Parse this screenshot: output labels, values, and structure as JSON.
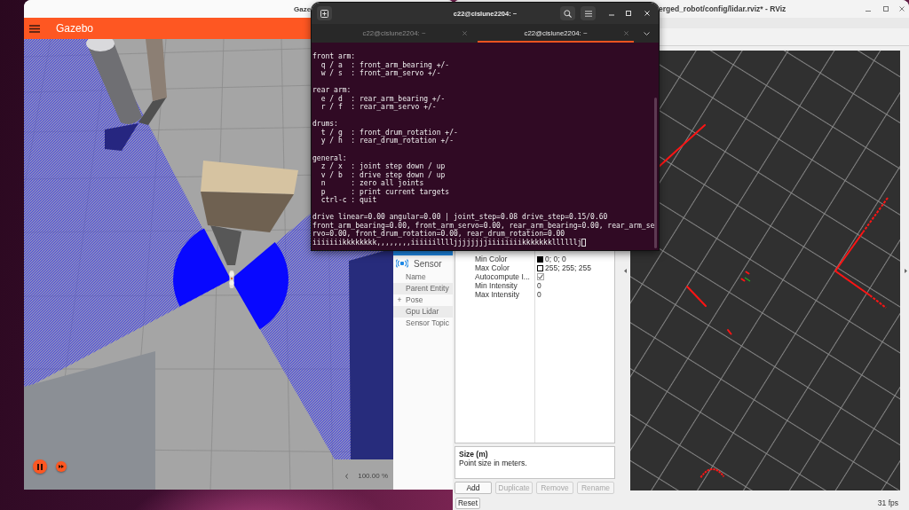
{
  "gazebo": {
    "title": "Gaze",
    "app_name": "Gazebo",
    "playing": true,
    "zoom": "100.00 %",
    "panel": {
      "title": "Sensor",
      "rows": [
        {
          "label": "Name"
        },
        {
          "label": "Parent Entity"
        },
        {
          "toggle": "+",
          "label": "Pose"
        },
        {
          "label": "Gpu Lidar"
        },
        {
          "label": "Sensor Topic"
        }
      ]
    }
  },
  "terminal": {
    "title": "c22@cislune2204: ~",
    "tabs": [
      {
        "label": "c22@cislune2204: ~",
        "selected": false
      },
      {
        "label": "c22@cislune2204: ~",
        "selected": true
      }
    ],
    "blocks": [
      [
        "front arm:",
        "  q / a  : front_arm_bearing +/-",
        "  w / s  : front_arm_servo +/-"
      ],
      [
        "rear arm:",
        "  e / d  : rear_arm_bearing +/-",
        "  r / f  : rear_arm_servo +/-"
      ],
      [
        "drums:",
        "  t / g  : front_drum_rotation +/-",
        "  y / h  : rear_drum_rotation +/-"
      ],
      [
        "general:",
        "  z / x  : joint step down / up",
        "  v / b  : drive step down / up",
        "  n      : zero all joints",
        "  p      : print current targets",
        "  ctrl-c : quit"
      ],
      [
        "drive linear=0.00 angular=0.00 | joint_step=0.08 drive_step=0.15/0.60",
        "front_arm_bearing=0.00, front_arm_servo=0.00, rear_arm_bearing=0.00, rear_arm_se",
        "rvo=0.00, front_drum_rotation=0.00, rear_drum_rotation=0.00",
        "iiiiiiikkkkkkkk,,,,,,,,iiiiiilllljjjjjjjjiiiiiiiikkkkkkkllllllj"
      ]
    ]
  },
  "rviz": {
    "title": "erged_robot/config/lidar.rviz* - RViz",
    "properties": [
      {
        "kind": "color",
        "name": "Min Color",
        "color": "#000000",
        "value": "0; 0; 0"
      },
      {
        "kind": "color",
        "name": "Max Color",
        "color": "#ffffff",
        "value": "255; 255; 255"
      },
      {
        "kind": "checkbox",
        "name": "Autocompute I...",
        "checked": true
      },
      {
        "kind": "text",
        "name": "Min Intensity",
        "value": "0"
      },
      {
        "kind": "text",
        "name": "Max Intensity",
        "value": "0"
      }
    ],
    "description": {
      "title": "Size (m)",
      "text": "Point size in meters."
    },
    "buttons": [
      {
        "label": "Add",
        "disabled": false
      },
      {
        "label": "Duplicate",
        "disabled": true
      },
      {
        "label": "Remove",
        "disabled": true
      },
      {
        "label": "Rename",
        "disabled": true
      }
    ],
    "reset": "Reset",
    "fps": "31 fps"
  }
}
